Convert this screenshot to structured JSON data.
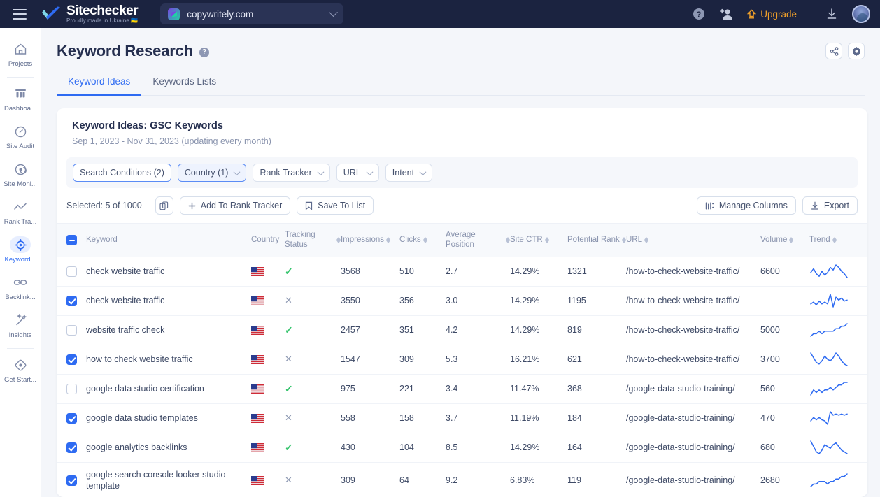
{
  "topbar": {
    "menu_icon": "hamburger-menu-icon",
    "brand_name": "Sitechecker",
    "brand_tagline": "Proudly made in Ukraine 🇺🇦",
    "site_selector": {
      "name": "copywritely.com",
      "icon": "site-logo-icon",
      "chevron": "chevron-down-icon"
    },
    "help_label": "?",
    "invite_icon": "add-user-icon",
    "upgrade_label": "Upgrade",
    "upgrade_color": "#f0a02a",
    "download_icon": "download-icon",
    "avatar": "user-avatar"
  },
  "sidebar": {
    "items": [
      {
        "label": "Projects",
        "icon": "home-icon",
        "active": false
      },
      {
        "label": "Dashboa...",
        "icon": "dashboard-icon",
        "active": false
      },
      {
        "label": "Site Audit",
        "icon": "gauge-icon",
        "active": false
      },
      {
        "label": "Site Moni...",
        "icon": "radar-icon",
        "active": false
      },
      {
        "label": "Rank Tra...",
        "icon": "trend-line-icon",
        "active": false
      },
      {
        "label": "Keyword...",
        "icon": "target-icon",
        "active": true
      },
      {
        "label": "Backlink...",
        "icon": "link-icon",
        "active": false
      },
      {
        "label": "Insights",
        "icon": "magic-wand-icon",
        "active": false
      },
      {
        "label": "Get Start...",
        "icon": "diamond-icon",
        "active": false
      }
    ]
  },
  "page": {
    "title": "Keyword Research",
    "help_icon": "help-circle-icon",
    "share_icon": "share-icon",
    "settings_icon": "gear-icon",
    "tabs": [
      {
        "label": "Keyword Ideas",
        "active": true
      },
      {
        "label": "Keywords Lists",
        "active": false
      }
    ]
  },
  "card": {
    "title": "Keyword Ideas: GSC Keywords",
    "subtitle": "Sep 1, 2023 - Nov 31, 2023 (updating every month)",
    "filters": [
      {
        "label": "Search Conditions (2)",
        "has_chevron": false,
        "selected": true,
        "shaded": false
      },
      {
        "label": "Country (1)",
        "has_chevron": true,
        "selected": true,
        "shaded": true
      },
      {
        "label": "Rank Tracker",
        "has_chevron": true,
        "selected": false,
        "shaded": false
      },
      {
        "label": "URL",
        "has_chevron": true,
        "selected": false,
        "shaded": false
      },
      {
        "label": "Intent",
        "has_chevron": true,
        "selected": false,
        "shaded": false
      }
    ],
    "toolbar": {
      "selected_text": "Selected: 5 of 1000",
      "copy_icon": "copy-icon",
      "add_to_rank_tracker": "Add To Rank Tracker",
      "save_to_list": "Save To List",
      "manage_columns": "Manage Columns",
      "export": "Export"
    }
  },
  "table": {
    "columns": [
      {
        "key": "keyword",
        "label": "Keyword",
        "sortable": false
      },
      {
        "key": "country",
        "label": "Country",
        "sortable": false
      },
      {
        "key": "tracking",
        "label": "Tracking Status",
        "sortable": true
      },
      {
        "key": "impressions",
        "label": "Impressions",
        "sortable": true
      },
      {
        "key": "clicks",
        "label": "Clicks",
        "sortable": true
      },
      {
        "key": "position",
        "label": "Average Position",
        "sortable": true
      },
      {
        "key": "ctr",
        "label": "Site CTR",
        "sortable": true
      },
      {
        "key": "potential",
        "label": "Potential Rank",
        "sortable": true
      },
      {
        "key": "url",
        "label": "URL",
        "sortable": true
      },
      {
        "key": "volume",
        "label": "Volume",
        "sortable": true
      },
      {
        "key": "trend",
        "label": "Trend",
        "sortable": true
      }
    ],
    "rows": [
      {
        "checked": false,
        "keyword": "check website traffic",
        "country": "US",
        "tracking": "tracked",
        "impressions": "3568",
        "clicks": "510",
        "position": "2.7",
        "ctr": "14.29%",
        "potential": "1321",
        "url": "/how-to-check-website-traffic/",
        "volume": "6600",
        "trend": [
          10,
          13,
          9,
          7,
          11,
          8,
          10,
          14,
          12,
          16,
          14,
          11,
          9,
          6
        ]
      },
      {
        "checked": true,
        "keyword": "check website traffic",
        "country": "US",
        "tracking": "untracked",
        "impressions": "3550",
        "clicks": "356",
        "position": "3.0",
        "ctr": "14.29%",
        "potential": "1195",
        "url": "/how-to-check-website-traffic/",
        "volume": "—",
        "trend": [
          9,
          11,
          8,
          12,
          9,
          11,
          9,
          19,
          6,
          16,
          13,
          15,
          12,
          13
        ]
      },
      {
        "checked": false,
        "keyword": "website traffic check",
        "country": "US",
        "tracking": "tracked",
        "impressions": "2457",
        "clicks": "351",
        "position": "4.2",
        "ctr": "14.29%",
        "potential": "819",
        "url": "/how-to-check-website-traffic/",
        "volume": "5000",
        "trend": [
          8,
          9,
          9,
          10,
          9,
          10,
          10,
          10,
          10,
          11,
          11,
          12,
          12,
          13
        ]
      },
      {
        "checked": true,
        "keyword": "how to check website traffic",
        "country": "US",
        "tracking": "untracked",
        "impressions": "1547",
        "clicks": "309",
        "position": "5.3",
        "ctr": "16.21%",
        "potential": "621",
        "url": "/how-to-check-website-traffic/",
        "volume": "3700",
        "trend": [
          15,
          12,
          9,
          8,
          10,
          13,
          11,
          10,
          12,
          15,
          13,
          10,
          8,
          7
        ]
      },
      {
        "checked": false,
        "keyword": "google data studio certification",
        "country": "US",
        "tracking": "tracked",
        "impressions": "975",
        "clicks": "221",
        "position": "3.4",
        "ctr": "11.47%",
        "potential": "368",
        "url": "/google-data-studio-training/",
        "volume": "560",
        "trend": [
          8,
          10,
          9,
          10,
          9,
          10,
          10,
          11,
          10,
          11,
          12,
          12,
          13,
          13
        ]
      },
      {
        "checked": true,
        "keyword": "google data studio templates",
        "country": "US",
        "tracking": "untracked",
        "impressions": "558",
        "clicks": "158",
        "position": "3.7",
        "ctr": "11.19%",
        "potential": "184",
        "url": "/google-data-studio-training/",
        "volume": "470",
        "trend": [
          9,
          12,
          10,
          12,
          10,
          9,
          6,
          17,
          14,
          15,
          14,
          15,
          14,
          15
        ]
      },
      {
        "checked": true,
        "keyword": "google analytics backlinks",
        "country": "US",
        "tracking": "tracked",
        "impressions": "430",
        "clicks": "104",
        "position": "8.5",
        "ctr": "14.29%",
        "potential": "164",
        "url": "/google-data-studio-training/",
        "volume": "680",
        "trend": [
          15,
          12,
          9,
          8,
          10,
          13,
          12,
          11,
          13,
          14,
          12,
          10,
          9,
          8
        ]
      },
      {
        "checked": true,
        "keyword": "google search console looker studio template",
        "country": "US",
        "tracking": "untracked",
        "impressions": "309",
        "clicks": "64",
        "position": "9.2",
        "ctr": "6.83%",
        "potential": "119",
        "url": "/google-data-studio-training/",
        "volume": "2680",
        "trend": [
          8,
          9,
          9,
          10,
          10,
          10,
          9,
          10,
          10,
          11,
          11,
          12,
          12,
          13
        ]
      }
    ]
  },
  "colors": {
    "accent": "#2e6bf2",
    "topbar": "#1b2340",
    "tracked": "#36c46d",
    "untracked": "#8f9ab3",
    "spark": "#2e6bf2"
  }
}
